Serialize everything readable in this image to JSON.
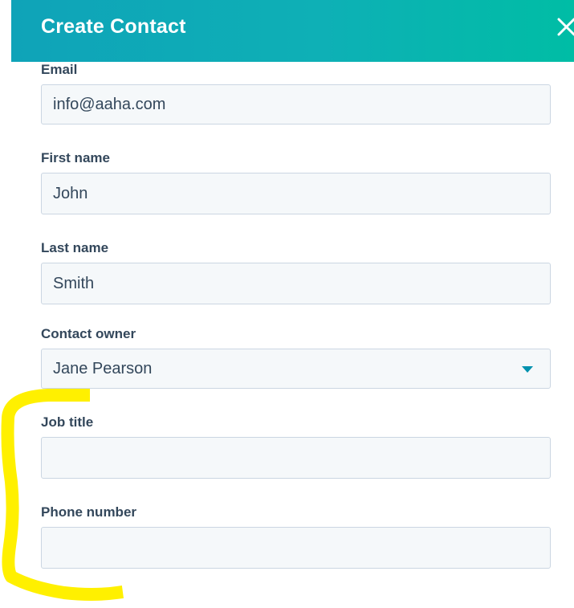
{
  "dialog": {
    "title": "Create Contact",
    "close_icon": "close-icon"
  },
  "fields": {
    "email": {
      "label": "Email",
      "value": "info@aaha.com"
    },
    "first_name": {
      "label": "First name",
      "value": "John"
    },
    "last_name": {
      "label": "Last name",
      "value": "Smith"
    },
    "contact_owner": {
      "label": "Contact owner",
      "value": "Jane Pearson",
      "icon": "chevron-down-icon"
    },
    "job_title": {
      "label": "Job title",
      "value": ""
    },
    "phone_number": {
      "label": "Phone number",
      "value": ""
    }
  },
  "colors": {
    "header_start": "#0fa3b8",
    "header_end": "#00bda5",
    "label_text": "#33475b",
    "input_bg": "#f5f8fa",
    "input_border": "#cbd6e2",
    "caret": "#0091ae",
    "annotation_highlight": "#fff000"
  }
}
